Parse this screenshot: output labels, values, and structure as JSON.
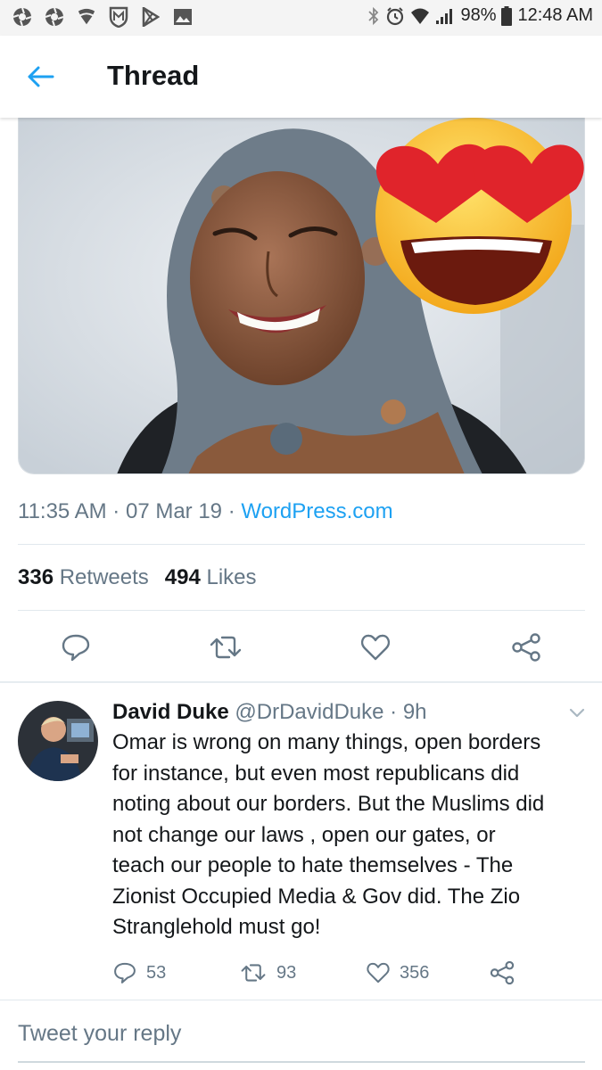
{
  "status_bar": {
    "left_icons": [
      "aperture-icon",
      "aperture-icon",
      "tulip-icon",
      "shield-m-icon",
      "play-store-icon",
      "gallery-icon"
    ],
    "right_icons": [
      "bluetooth-icon",
      "alarm-icon",
      "wifi-icon",
      "signal-icon",
      "battery-icon"
    ],
    "battery": "98%",
    "time": "12:48 AM"
  },
  "header": {
    "back_icon": "arrow-left-icon",
    "title": "Thread"
  },
  "tweet": {
    "time": "11:35 AM",
    "sep1": "·",
    "date": "07 Mar 19",
    "sep2": "·",
    "source": "WordPress.com",
    "retweet_count": "336",
    "retweet_label": "Retweets",
    "like_count": "494",
    "like_label": "Likes",
    "actions": [
      "reply-icon",
      "retweet-icon",
      "like-icon",
      "share-icon"
    ]
  },
  "reply": {
    "name": "David Duke",
    "handle": "@DrDavidDuke",
    "sep": "·",
    "age": "9h",
    "lines": [
      "Omar is wrong on many things, open borders",
      "for instance, but even most republicans did",
      "noting about our borders. But the Muslims did",
      "not change our laws , open our gates, or",
      "teach our people to hate themselves - The",
      "Zionist Occupied Media & Gov did. The Zio",
      "Stranglehold must go!"
    ],
    "reply_count": "53",
    "retweet_count": "93",
    "like_count": "356"
  },
  "compose": {
    "placeholder": "Tweet your reply"
  },
  "colors": {
    "accent": "#1da1f2",
    "secondary_text": "#657786",
    "primary_text": "#14171a"
  }
}
